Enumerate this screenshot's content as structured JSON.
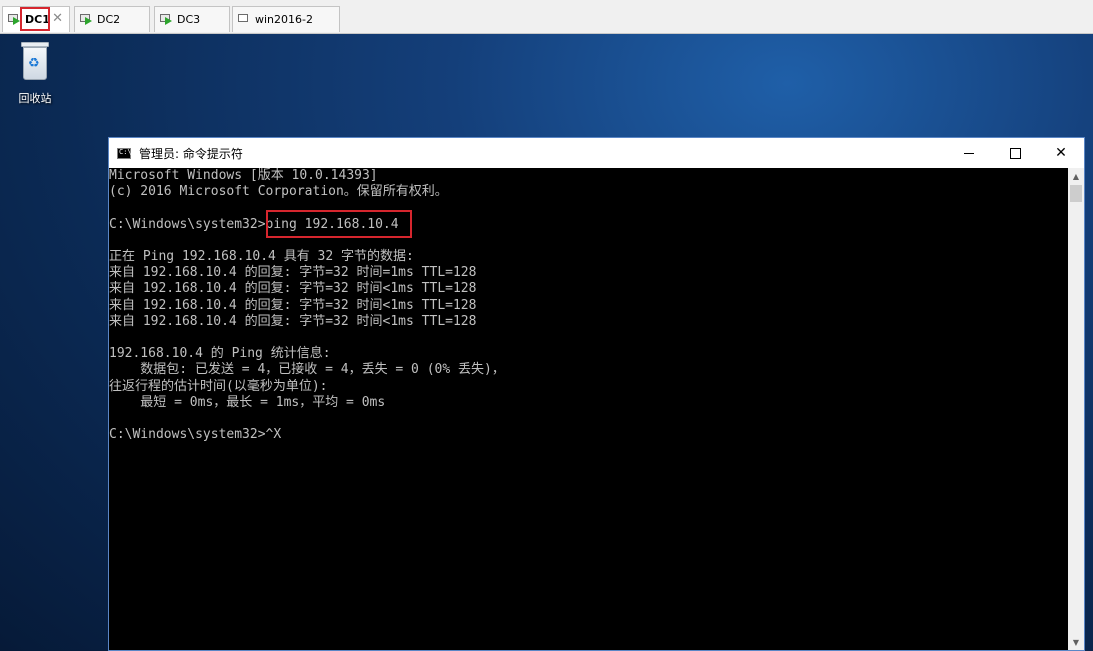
{
  "tabs": [
    {
      "label": "DC1",
      "active": true
    },
    {
      "label": "DC2",
      "active": false
    },
    {
      "label": "DC3",
      "active": false
    },
    {
      "label": "win2016-2",
      "active": false
    }
  ],
  "desktop": {
    "recycle_bin_label": "回收站"
  },
  "window": {
    "title": "管理员: 命令提示符",
    "minimize": "—",
    "maximize": "□",
    "close": "✕",
    "console_lines": [
      "Microsoft Windows [版本 10.0.14393]",
      "(c) 2016 Microsoft Corporation。保留所有权利。",
      "",
      "C:\\Windows\\system32>ping 192.168.10.4",
      "",
      "正在 Ping 192.168.10.4 具有 32 字节的数据:",
      "来自 192.168.10.4 的回复: 字节=32 时间=1ms TTL=128",
      "来自 192.168.10.4 的回复: 字节=32 时间<1ms TTL=128",
      "来自 192.168.10.4 的回复: 字节=32 时间<1ms TTL=128",
      "来自 192.168.10.4 的回复: 字节=32 时间<1ms TTL=128",
      "",
      "192.168.10.4 的 Ping 统计信息:",
      "    数据包: 已发送 = 4，已接收 = 4，丢失 = 0 (0% 丢失)，",
      "往返行程的估计时间(以毫秒为单位):",
      "    最短 = 0ms，最长 = 1ms，平均 = 0ms",
      "",
      "C:\\Windows\\system32>^X"
    ]
  },
  "colors": {
    "highlight_outline": "#d6262e",
    "console_bg": "#000000",
    "console_text": "#c0c0c0"
  }
}
